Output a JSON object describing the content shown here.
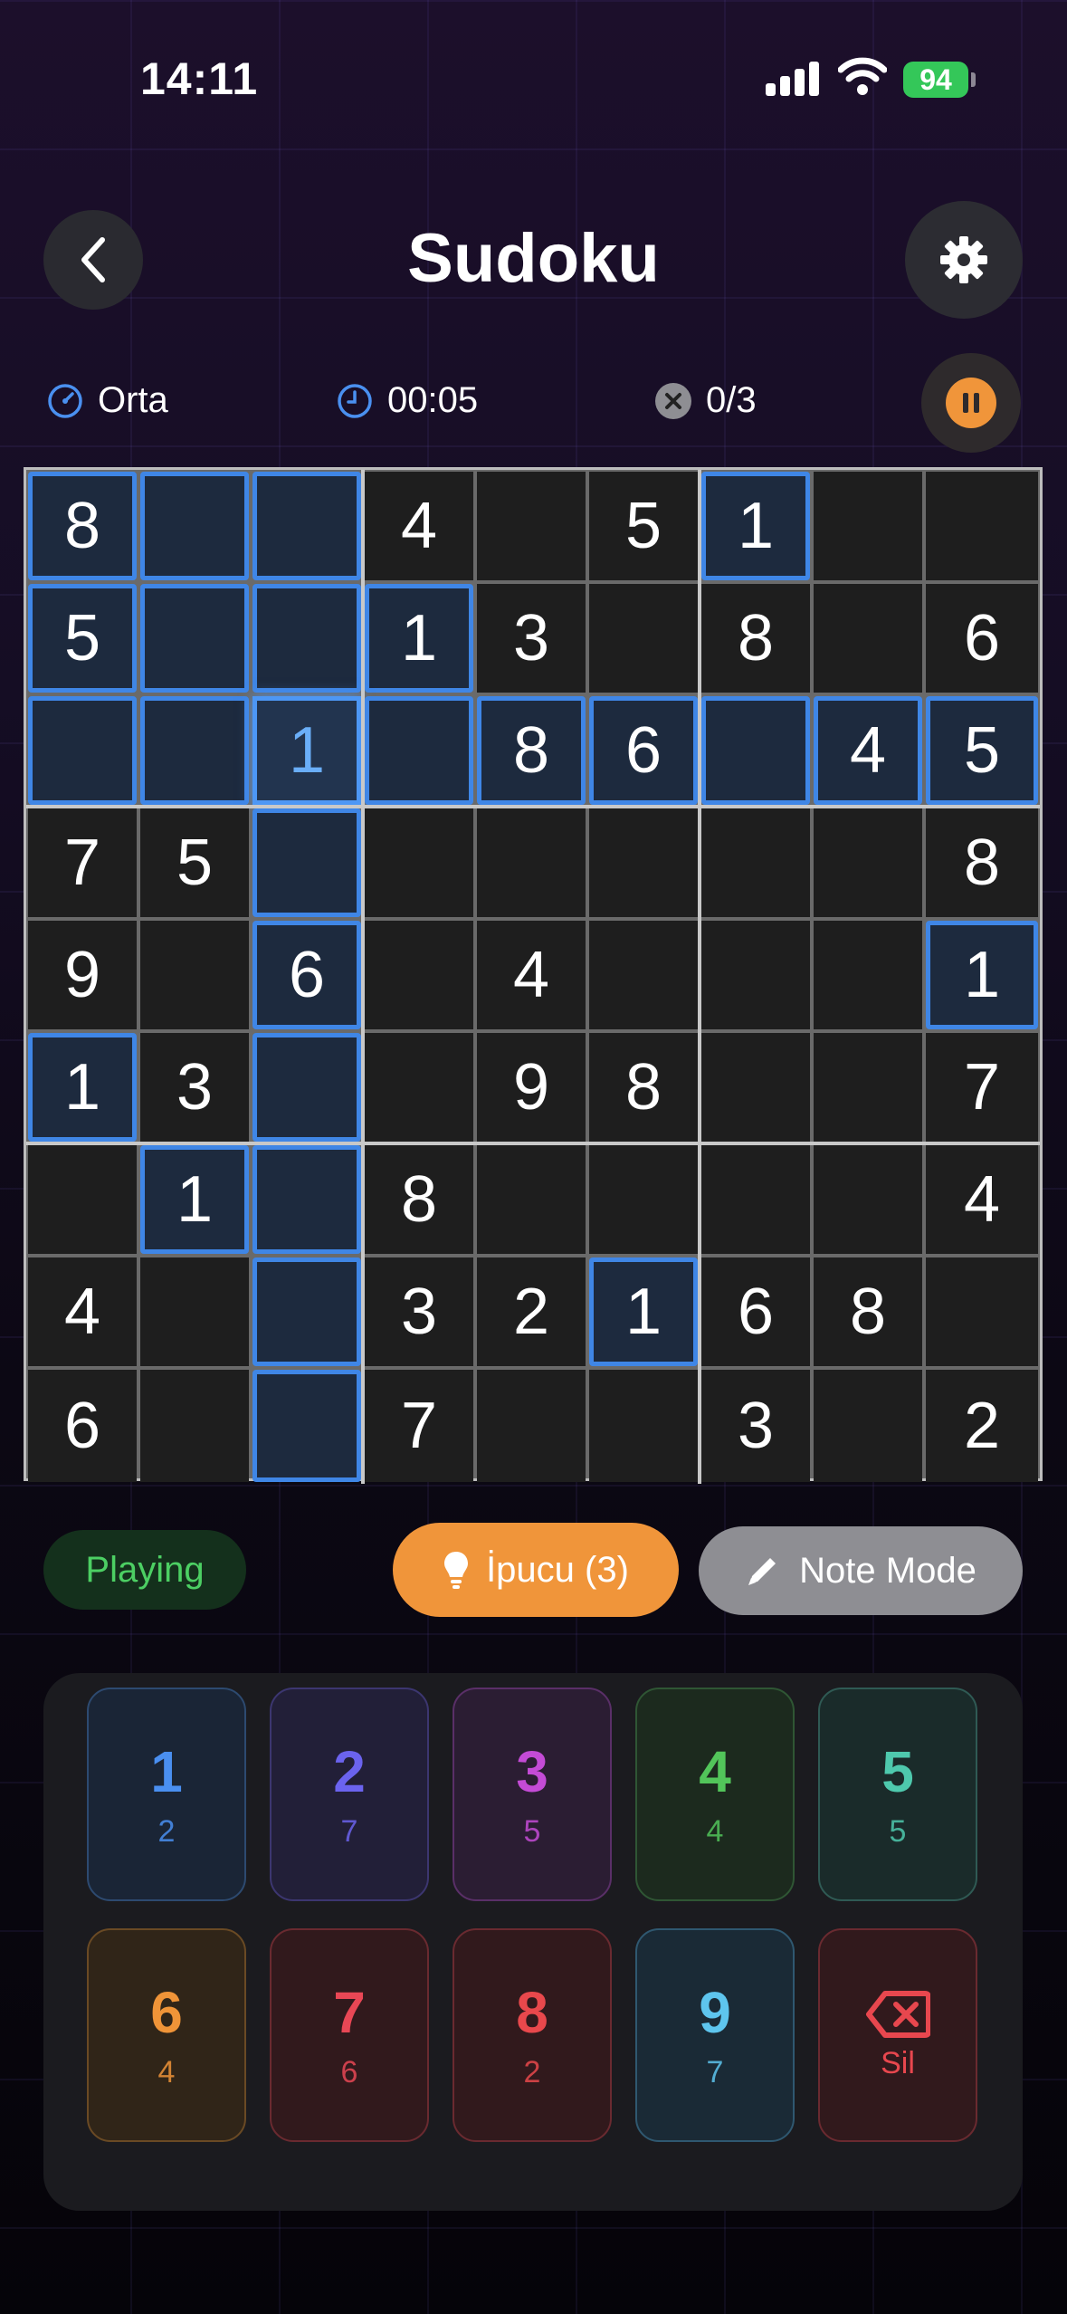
{
  "status_bar": {
    "time": "14:11",
    "battery": "94"
  },
  "header": {
    "title": "Sudoku"
  },
  "info": {
    "difficulty": "Orta",
    "timer": "00:05",
    "mistakes": "0/3"
  },
  "board": {
    "cells": [
      [
        "8",
        "",
        "",
        "4",
        "",
        "5",
        "1",
        "",
        ""
      ],
      [
        "5",
        "",
        "",
        "1",
        "3",
        "",
        "8",
        "",
        "6"
      ],
      [
        "",
        "",
        "1",
        "",
        "8",
        "6",
        "",
        "4",
        "5"
      ],
      [
        "7",
        "5",
        "",
        "",
        "",
        "",
        "",
        "",
        "8"
      ],
      [
        "9",
        "",
        "6",
        "",
        "4",
        "",
        "",
        "",
        "1"
      ],
      [
        "1",
        "3",
        "",
        "",
        "9",
        "8",
        "",
        "",
        "7"
      ],
      [
        "",
        "1",
        "",
        "8",
        "",
        "",
        "",
        "",
        "4"
      ],
      [
        "4",
        "",
        "",
        "3",
        "2",
        "1",
        "6",
        "8",
        ""
      ],
      [
        "6",
        "",
        "",
        "7",
        "",
        "",
        "3",
        "",
        "2"
      ]
    ],
    "highlighted": [
      [
        0,
        0
      ],
      [
        0,
        1
      ],
      [
        0,
        2
      ],
      [
        0,
        6
      ],
      [
        1,
        0
      ],
      [
        1,
        1
      ],
      [
        1,
        2
      ],
      [
        1,
        3
      ],
      [
        2,
        0
      ],
      [
        2,
        1
      ],
      [
        2,
        3
      ],
      [
        2,
        4
      ],
      [
        2,
        5
      ],
      [
        2,
        6
      ],
      [
        2,
        7
      ],
      [
        2,
        8
      ],
      [
        3,
        2
      ],
      [
        4,
        2
      ],
      [
        4,
        8
      ],
      [
        5,
        0
      ],
      [
        5,
        2
      ],
      [
        6,
        1
      ],
      [
        6,
        2
      ],
      [
        7,
        2
      ],
      [
        7,
        5
      ],
      [
        8,
        2
      ]
    ],
    "selected": [
      2,
      2
    ]
  },
  "controls": {
    "status": "Playing",
    "hint_label": "İpucu (3)",
    "note_label": "Note Mode"
  },
  "numpad": {
    "keys": [
      {
        "number": "1",
        "count": "2",
        "color": "#4a8ff0",
        "bg": "#1a2536",
        "border": "#2d4a70"
      },
      {
        "number": "2",
        "count": "7",
        "color": "#6b63ee",
        "bg": "#221f38",
        "border": "#3c3670"
      },
      {
        "number": "3",
        "count": "5",
        "color": "#c44bd6",
        "bg": "#2b1d33",
        "border": "#5a2f68"
      },
      {
        "number": "4",
        "count": "4",
        "color": "#52c55a",
        "bg": "#1c2a1e",
        "border": "#2f5634"
      },
      {
        "number": "5",
        "count": "5",
        "color": "#4ec9ad",
        "bg": "#1a2b2a",
        "border": "#2f5a54"
      },
      {
        "number": "6",
        "count": "4",
        "color": "#ef9438",
        "bg": "#302518",
        "border": "#6a4a24"
      },
      {
        "number": "7",
        "count": "6",
        "color": "#e84755",
        "bg": "#31191c",
        "border": "#6a2a30"
      },
      {
        "number": "8",
        "count": "2",
        "color": "#e8484c",
        "bg": "#31191c",
        "border": "#6a2a30"
      },
      {
        "number": "9",
        "count": "7",
        "color": "#5ec5ee",
        "bg": "#1a2a36",
        "border": "#2f5870"
      }
    ],
    "delete": {
      "label": "Sil",
      "color": "#e8474e",
      "bg": "#31191c",
      "border": "#6a2a30"
    }
  }
}
